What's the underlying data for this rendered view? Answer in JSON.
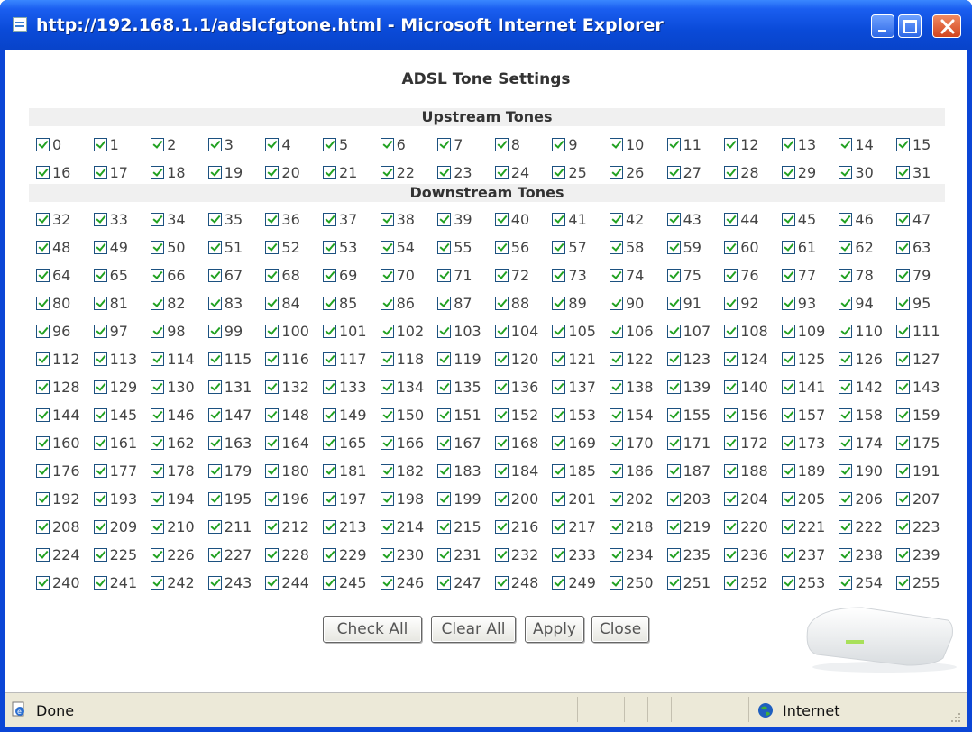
{
  "window": {
    "title": "http://192.168.1.1/adslcfgtone.html - Microsoft Internet Explorer"
  },
  "page": {
    "title": "ADSL Tone Settings",
    "upstream_header": "Upstream Tones",
    "downstream_header": "Downstream Tones",
    "upstream_range": [
      0,
      31
    ],
    "downstream_range": [
      32,
      255
    ],
    "tones_per_row": 16,
    "all_checked": true
  },
  "buttons": {
    "check_all": "Check All",
    "clear_all": "Clear All",
    "apply": "Apply",
    "close": "Close"
  },
  "statusbar": {
    "status": "Done",
    "zone": "Internet"
  },
  "colors": {
    "titlebar": "#0a4ad8",
    "checkmark": "#21a121",
    "section_bg": "#f0f0f0"
  }
}
